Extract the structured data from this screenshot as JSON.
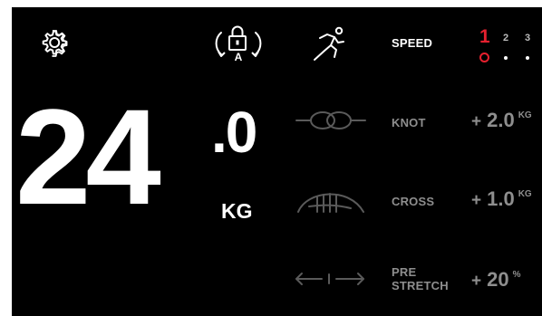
{
  "weight": {
    "integer": "24",
    "decimal": ".0",
    "unit": "KG"
  },
  "icons": {
    "settings": "gear-icon",
    "lock": "auto-lock-icon",
    "lock_letter": "A",
    "sprint": "sprint-icon",
    "knot": "knot-icon",
    "cross": "cross-icon",
    "stretch": "pre-stretch-arrows-icon"
  },
  "speed": {
    "label": "SPEED",
    "options": [
      "1",
      "2",
      "3"
    ],
    "selected": "1"
  },
  "knot": {
    "label": "KNOT",
    "sign": "+",
    "value": "2.0",
    "unit": "KG"
  },
  "cross": {
    "label": "CROSS",
    "sign": "+",
    "value": "1.0",
    "unit": "KG"
  },
  "pre_stretch": {
    "label_line1": "PRE",
    "label_line2": "STRETCH",
    "sign": "+",
    "value": "20",
    "unit": "%"
  },
  "colors": {
    "background": "#000000",
    "primary_text": "#ffffff",
    "inactive_text": "#8e8e8e",
    "accent": "#e5202e"
  }
}
